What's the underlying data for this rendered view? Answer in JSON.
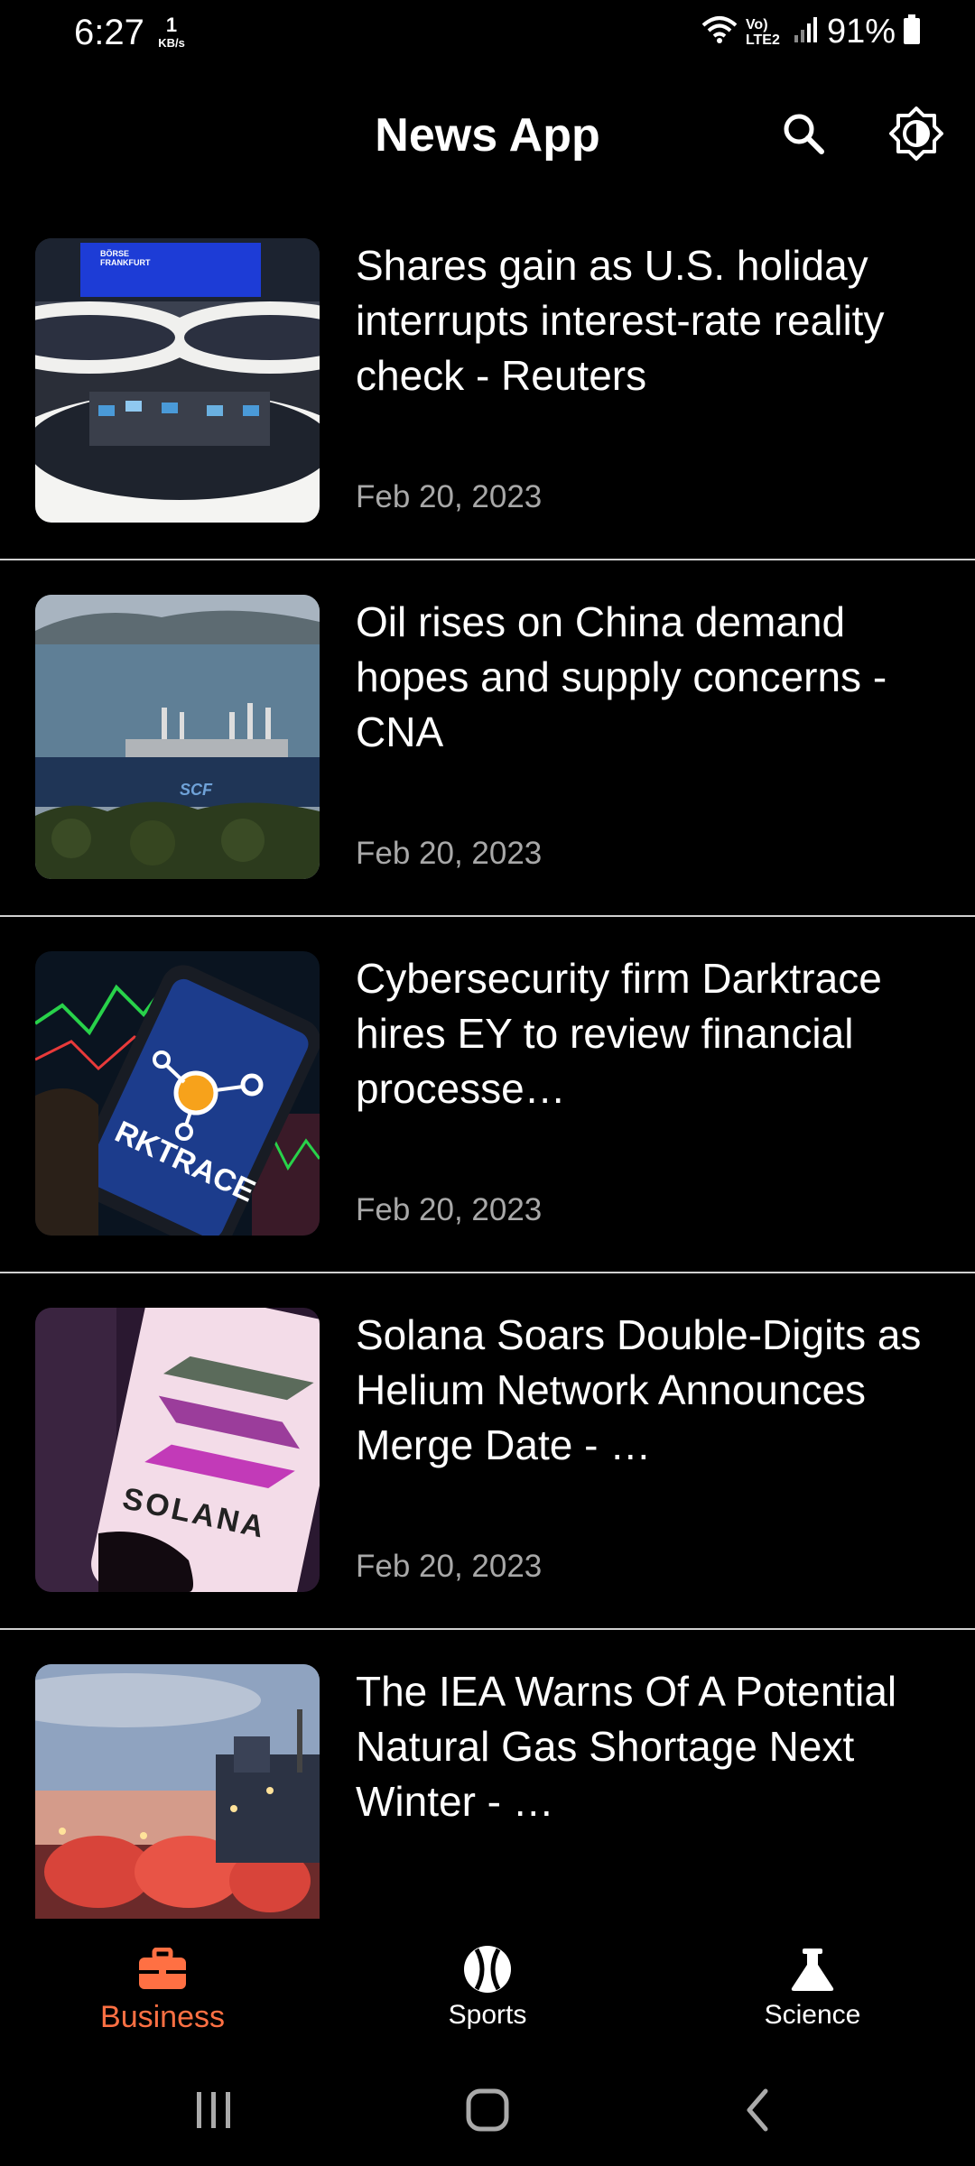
{
  "status_bar": {
    "time": "6:27",
    "speed_value": "1",
    "speed_unit": "KB/s",
    "network": "Vo) LTE2",
    "battery": "91%"
  },
  "header": {
    "title": "News App"
  },
  "articles": [
    {
      "title": "Shares gain as U.S. holiday interrupts interest-rate reality check - Reuters",
      "date": "Feb 20, 2023"
    },
    {
      "title": "Oil rises on China demand hopes and supply concerns - CNA",
      "date": "Feb 20, 2023"
    },
    {
      "title": "Cybersecurity firm Darktrace hires EY to review financial processe…",
      "date": "Feb 20, 2023"
    },
    {
      "title": "Solana Soars Double-Digits as Helium Network Announces Merge Date - …",
      "date": "Feb 20, 2023"
    },
    {
      "title": "The IEA Warns Of A Potential Natural Gas Shortage Next Winter - …",
      "date": ""
    }
  ],
  "thumb_text": {
    "borse": "BÖRSE",
    "frankfurt": "FRANKFURT",
    "ship": "SCF",
    "darktrace": "RKTRACE",
    "solana": "SOLANA"
  },
  "bottom_nav": {
    "items": [
      {
        "label": "Business",
        "icon": "briefcase-icon",
        "active": true
      },
      {
        "label": "Sports",
        "icon": "baseball-icon",
        "active": false
      },
      {
        "label": "Science",
        "icon": "flask-icon",
        "active": false
      }
    ]
  },
  "colors": {
    "accent": "#ff7043",
    "background": "#000000",
    "date_text": "#a8a8a8",
    "divider": "#d0d0d0"
  }
}
